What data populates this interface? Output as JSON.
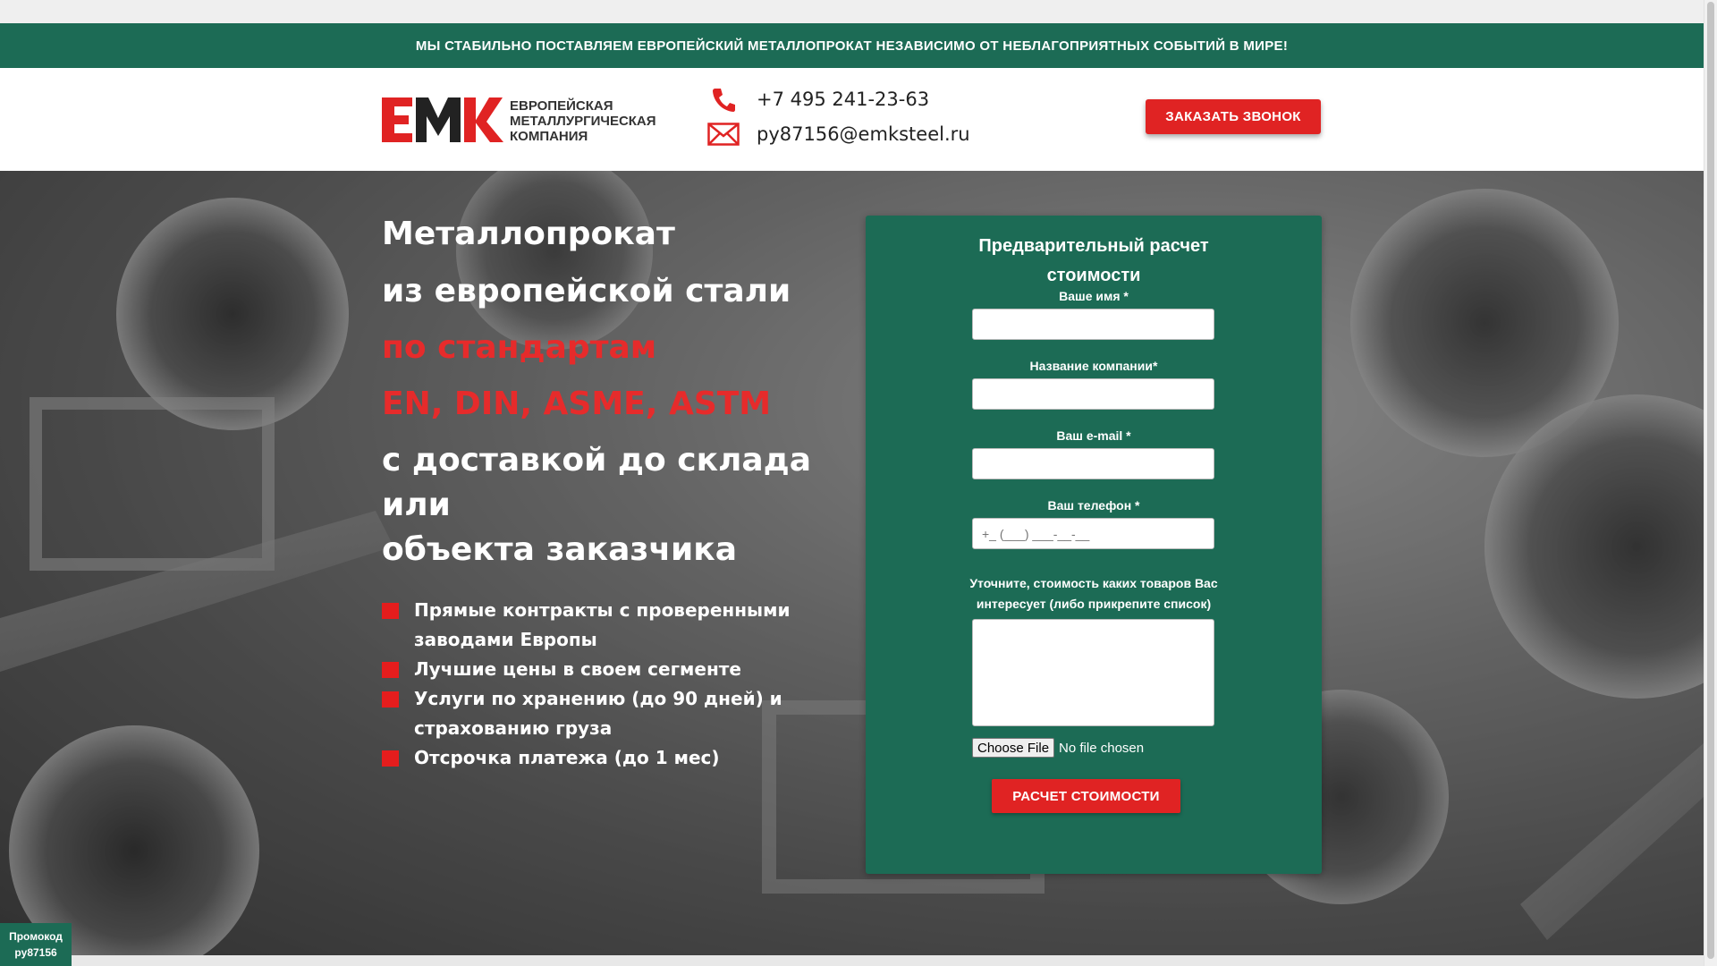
{
  "banner": {
    "text": "МЫ СТАБИЛЬНО ПОСТАВЛЯЕМ ЕВРОПЕЙСКИЙ МЕТАЛЛОПРОКАТ НЕЗАВИСИМО ОТ НЕБЛАГОПРИЯТНЫХ СОБЫТИЙ В МИРЕ!"
  },
  "header": {
    "logo": {
      "mark": "EMK",
      "line1": "ЕВРОПЕЙСКАЯ",
      "line2": "МЕТАЛЛУРГИЧЕСКАЯ",
      "line3": "КОМПАНИЯ"
    },
    "phone": "+7 495 241-23-63",
    "email": "py87156@emksteel.ru",
    "callback_label": "ЗАКАЗАТЬ ЗВОНОК"
  },
  "hero": {
    "headline": {
      "line1": "Металлопрокат",
      "line2": "из европейской стали",
      "line3": "по стандартам",
      "line4": "EN, DIN, ASME, ASTM",
      "line5": "с доставкой до склада или",
      "line6": "объекта заказчика"
    },
    "benefits": [
      "Прямые контракты с проверенными заводами Европы",
      "Лучшие цены в своем сегменте",
      "Услуги по хранению (до 90 дней) и страхованию груза",
      "Отсрочка платежа (до 1 мес)"
    ]
  },
  "form": {
    "title_line1": "Предварительный расчет",
    "title_line2": "стоимости",
    "name_label": "Ваше имя *",
    "company_label": "Название компании*",
    "email_label": "Ваш e-mail *",
    "phone_label": "Ваш телефон *",
    "phone_placeholder": "+_ (___) ___-__-__",
    "items_label_line1": "Уточните, стоимость каких товаров Вас",
    "items_label_line2": "интересует (либо прикрепите список)",
    "file_button": "Choose File",
    "file_status": "No file chosen",
    "submit_label": "РАСЧЕТ СТОИМОСТИ"
  },
  "promo": {
    "line1": "Промокод",
    "line2": "py87156"
  },
  "colors": {
    "brand_green": "#1c6b55",
    "accent_red": "#e02323"
  }
}
